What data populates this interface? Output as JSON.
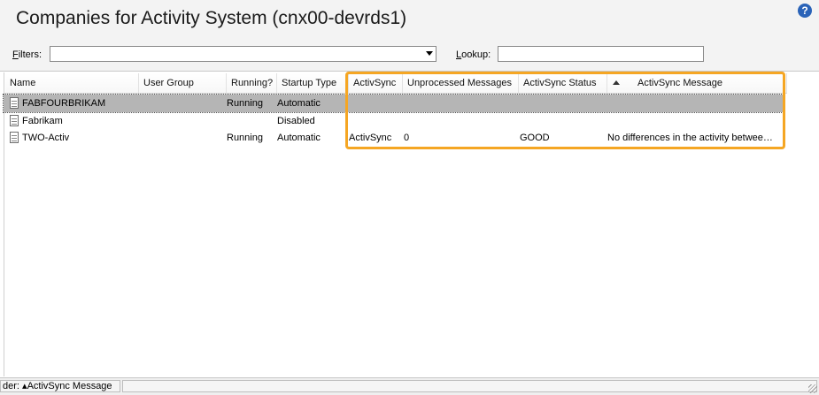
{
  "window": {
    "title": "Companies for Activity System (cnx00-devrds1)",
    "help_icon": "?"
  },
  "filters": {
    "filters_label_first": "F",
    "filters_label_rest": "ilters:",
    "lookup_label_first": "L",
    "lookup_label_rest": "ookup:",
    "filter_value": "",
    "lookup_value": ""
  },
  "table": {
    "columns": [
      "Name",
      "User Group",
      "Running?",
      "Startup Type",
      "ActivSync",
      "Unprocessed Messages",
      "ActivSync Status",
      "ActivSync Message"
    ],
    "rows": [
      {
        "name": "FABFOURBRIKAM",
        "user_group": "",
        "running": "Running",
        "startup": "Automatic",
        "activsync": "",
        "unprocessed": "",
        "status": "",
        "message": ""
      },
      {
        "name": "Fabrikam",
        "user_group": "",
        "running": "",
        "startup": "Disabled",
        "activsync": "",
        "unprocessed": "",
        "status": "",
        "message": ""
      },
      {
        "name": "TWO-Activ",
        "user_group": "",
        "running": "Running",
        "startup": "Automatic",
        "activsync": "ActivSync",
        "unprocessed": "0",
        "status": "GOOD",
        "message": "No differences in the activity betwee…"
      }
    ]
  },
  "statusbar": {
    "prefix": "der:",
    "sort_text": "ActivSync Message",
    "sort_marker": "▴"
  },
  "colors": {
    "highlight": "#f5a623",
    "selected_row": "#b5b5b5",
    "help_icon": "#2a63b8"
  }
}
